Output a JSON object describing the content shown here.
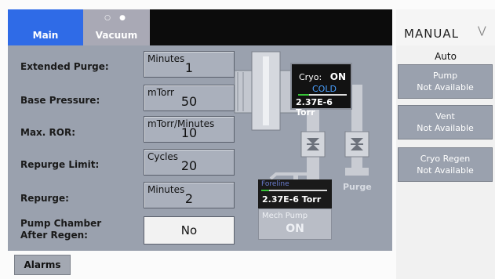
{
  "tabs": [
    {
      "label": "Main",
      "active": true
    },
    {
      "label": "Vacuum",
      "active": false
    }
  ],
  "tab_dots": "○ ●",
  "params": [
    {
      "label": "Extended Purge:",
      "unit": "Minutes",
      "value": "1"
    },
    {
      "label": "Base Pressure:",
      "unit": "mTorr",
      "value": "50"
    },
    {
      "label": "Max. ROR:",
      "unit": "mTorr/Minutes",
      "value": "10"
    },
    {
      "label": "Repurge Limit:",
      "unit": "Cycles",
      "value": "20"
    },
    {
      "label": "Repurge:",
      "unit": "Minutes",
      "value": "2"
    }
  ],
  "pump_chamber": {
    "label_line1": "Pump Chamber",
    "label_line2": "After Regen:",
    "value": "No"
  },
  "alarms_label": "Alarms",
  "mode": {
    "label": "MANUAL",
    "icon": "chevron-down-double-icon"
  },
  "auto_label": "Auto",
  "right_buttons": [
    {
      "title": "Pump",
      "status": "Not Available"
    },
    {
      "title": "Vent",
      "status": "Not Available"
    },
    {
      "title": "Cryo Regen",
      "status": "Not Available"
    }
  ],
  "cryo": {
    "label": "Cryo:",
    "state": "ON",
    "temp": "COLD",
    "pressure": "2.37E-6 Torr"
  },
  "foreline": {
    "label": "Foreline",
    "pressure": "2.37E-6 Torr"
  },
  "mech_pump": {
    "label": "Mech Pump",
    "state": "ON"
  },
  "purge_label": "Purge",
  "colors": {
    "active_tab": "#2f6be7",
    "panel": "#9aa1ae",
    "cold_text": "#4aa0ff",
    "field": "#aab0bc"
  }
}
